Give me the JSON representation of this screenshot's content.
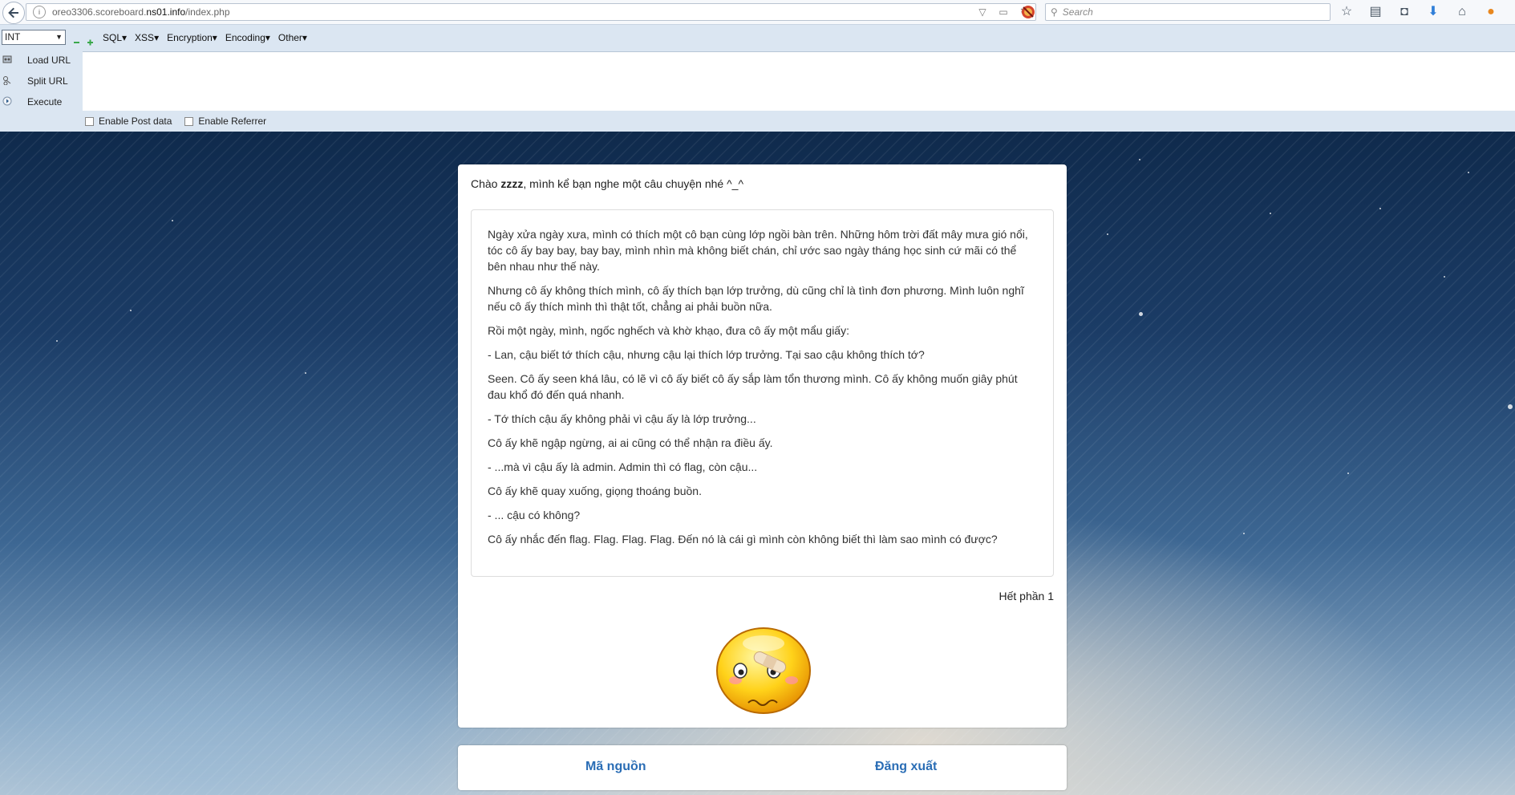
{
  "browser": {
    "url_prefix": "oreo3306.scoreboard.",
    "url_domain": "ns01.info",
    "url_path": "/index.php",
    "search_placeholder": "Search"
  },
  "hackbar": {
    "select_value": "INT",
    "menus": [
      "SQL",
      "XSS",
      "Encoding",
      "Encryption",
      "Other"
    ],
    "menu_order": [
      "SQL",
      "XSS",
      "Encryption",
      "Encoding",
      "Other"
    ],
    "load_url": "Load URL",
    "split_url": "Split URL",
    "execute": "Execute",
    "enable_post": "Enable Post data",
    "enable_referrer": "Enable Referrer"
  },
  "page": {
    "greeting_pre": "Chào ",
    "greeting_name": "zzzz",
    "greeting_post": ", mình kể bạn nghe một câu chuyện nhé ^_^",
    "paragraphs": [
      "Ngày xửa ngày xưa, mình có thích một cô bạn cùng lớp ngồi bàn trên. Những hôm trời đất mây mưa gió nổi, tóc cô ấy bay bay, bay bay, mình nhìn mà không biết chán, chỉ ước sao ngày tháng học sinh cứ mãi có thể bên nhau như thế này.",
      "Nhưng cô ấy không thích mình, cô ấy thích bạn lớp trưởng, dù cũng chỉ là tình đơn phương. Mình luôn nghĩ nếu cô ấy thích mình thì thật tốt, chẳng ai phải buồn nữa.",
      "Rồi một ngày, mình, ngốc nghếch và khờ khạo, đưa cô ấy một mẩu giấy:",
      "- Lan, cậu biết tớ thích cậu, nhưng cậu lại thích lớp trưởng. Tại sao cậu không thích tớ?",
      "Seen. Cô ấy seen khá lâu, có lẽ vì cô ấy biết cô ấy sắp làm tổn thương mình. Cô ấy không muốn giây phút đau khổ đó đến quá nhanh.",
      "- Tớ thích cậu ấy không phải vì cậu ấy là lớp trưởng...",
      "Cô ấy khẽ ngập ngừng, ai ai cũng có thể nhận ra điều ấy.",
      "- ...mà vì cậu ấy là admin. Admin thì có flag, còn cậu...",
      "Cô ấy khẽ quay xuống, giọng thoáng buồn.",
      "- ... cậu có không?",
      "Cô ấy nhắc đến flag. Flag. Flag. Flag. Đến nó là cái gì mình còn không biết thì làm sao mình có được?"
    ],
    "end_label": "Hết phần 1",
    "source_link": "Mã nguồn",
    "logout_link": "Đăng xuất"
  },
  "colors": {
    "link": "#2a6db5",
    "hackbar_bg": "#dbe6f2"
  }
}
